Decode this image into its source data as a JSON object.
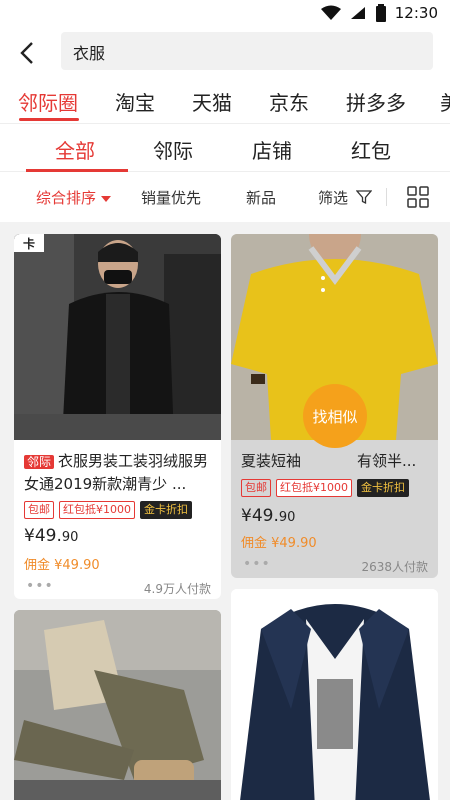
{
  "status": {
    "time": "12:30"
  },
  "search": {
    "query": "衣服"
  },
  "platform_tabs": [
    "邻际圈",
    "淘宝",
    "天猫",
    "京东",
    "拼多多",
    "美"
  ],
  "sub_tabs": [
    "全部",
    "邻际",
    "店铺",
    "红包"
  ],
  "filters": {
    "sort": "综合排序",
    "sales": "销量优先",
    "new": "新品",
    "filter": "筛选"
  },
  "products": [
    {
      "label": "邻际",
      "title": "衣服男装工装羽绒服男女通2019新款潮青少 ...",
      "tags": [
        "包邮",
        "红包抵¥1000",
        "金卡折扣"
      ],
      "price_main": "¥49.",
      "price_dec": "90",
      "commission": "佣金 ¥49.90",
      "sold": "4.9万人付款",
      "corner": "卡"
    },
    {
      "title": "夏装短袖",
      "title_tail": "有领半...",
      "tags": [
        "包邮",
        "红包抵¥1000",
        "金卡折扣"
      ],
      "price_main": "¥49.",
      "price_dec": "90",
      "commission": "佣金 ¥49.90",
      "sold": "2638人付款",
      "find_similar": "找相似"
    }
  ],
  "colors": {
    "accent": "#e53935",
    "orange": "#f5a11b",
    "commission": "#f08c2a"
  }
}
